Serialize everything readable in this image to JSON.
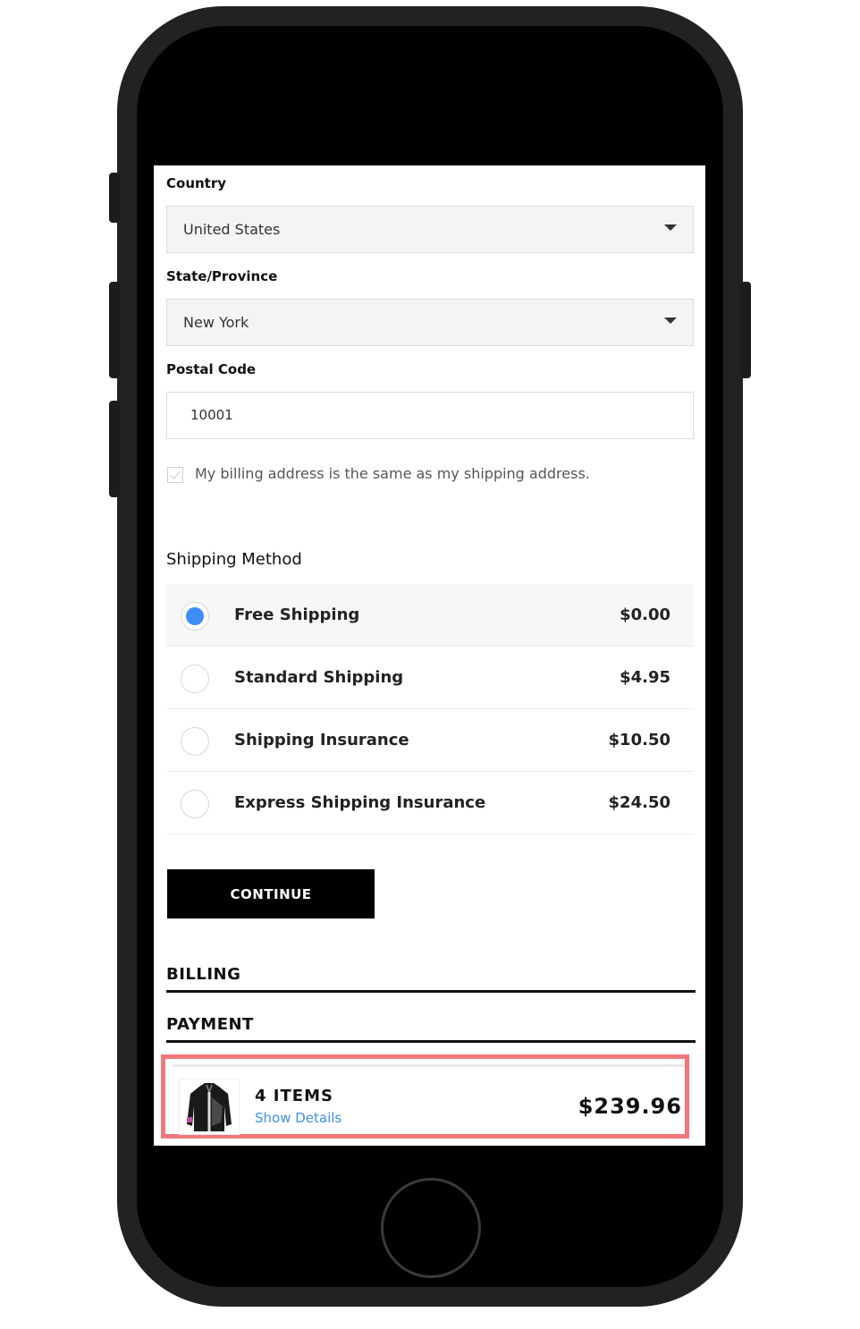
{
  "form": {
    "country_label": "Country",
    "country_value": "United States",
    "state_label": "State/Province",
    "state_value": "New York",
    "postal_label": "Postal Code",
    "postal_value": "10001",
    "billing_same_label": "My billing address is the same as my shipping address.",
    "billing_same_checked": true
  },
  "shipping": {
    "title": "Shipping Method",
    "options": [
      {
        "name": "Free Shipping",
        "price": "$0.00",
        "selected": true
      },
      {
        "name": "Standard Shipping",
        "price": "$4.95",
        "selected": false
      },
      {
        "name": "Shipping Insurance",
        "price": "$10.50",
        "selected": false
      },
      {
        "name": "Express Shipping Insurance",
        "price": "$24.50",
        "selected": false
      }
    ]
  },
  "continue_label": "CONTINUE",
  "steps": {
    "billing": "BILLING",
    "payment": "PAYMENT"
  },
  "summary": {
    "items_count": "4 ITEMS",
    "show_details": "Show Details",
    "total": "$239.96",
    "product_icon": "jacket-thumbnail-icon"
  },
  "colors": {
    "accent_blue": "#3e8ef7",
    "link_blue": "#3d8fe6",
    "highlight_red": "#f0787c"
  }
}
